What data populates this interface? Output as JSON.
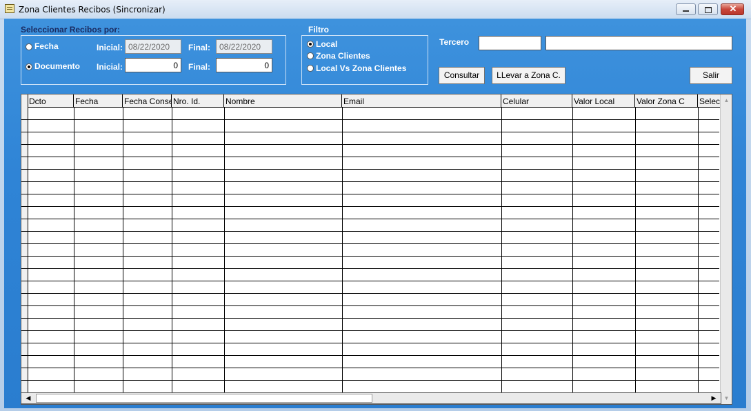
{
  "window": {
    "title": "Zona Clientes Recibos (Sincronizar)"
  },
  "select_by": {
    "heading": "Seleccionar Recibos por:",
    "fecha": {
      "label": "Fecha",
      "selected": false
    },
    "documento": {
      "label": "Documento",
      "selected": true
    },
    "inicial_label": "Inicial:",
    "final_label": "Final:",
    "fecha_inicial": "08/22/2020",
    "fecha_final": "08/22/2020",
    "doc_inicial": "0",
    "doc_final": "0"
  },
  "filtro": {
    "heading": "Filtro",
    "options": [
      {
        "label": "Local",
        "selected": true
      },
      {
        "label": "Zona Clientes",
        "selected": false
      },
      {
        "label": "Local Vs Zona Clientes",
        "selected": false
      }
    ]
  },
  "tercero": {
    "label": "Tercero",
    "code": "",
    "name": ""
  },
  "buttons": {
    "consultar": "Consultar",
    "llevar": "LLevar a  Zona C.",
    "salir": "Salir"
  },
  "grid": {
    "columns": [
      "Dcto",
      "Fecha",
      "Fecha Consecutivo",
      "Nro. Id.",
      "Nombre",
      "Email",
      "Celular",
      "Valor Local",
      "Valor Zona C",
      "Seleccionar"
    ],
    "rows": []
  }
}
